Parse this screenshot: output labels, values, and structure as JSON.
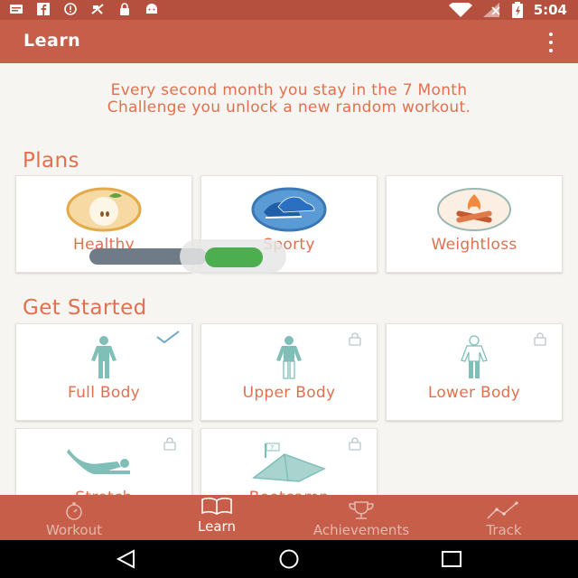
{
  "status": {
    "time": "5:04"
  },
  "appbar": {
    "title": "Learn"
  },
  "intro": {
    "line1": "Every second month you stay in the 7 Month",
    "line2": "Challenge you unlock a new random workout."
  },
  "plans": {
    "title": "Plans",
    "items": [
      {
        "label": "Healthy",
        "icon": "apple-icon"
      },
      {
        "label": "Sporty",
        "icon": "sneakers-icon"
      },
      {
        "label": "Weightloss",
        "icon": "campfire-icon"
      }
    ]
  },
  "toggle": {
    "state": "on"
  },
  "started": {
    "title": "Get Started",
    "items": [
      {
        "label": "Full Body",
        "status": "completed"
      },
      {
        "label": "Upper Body",
        "status": "locked"
      },
      {
        "label": "Lower Body",
        "status": "locked"
      },
      {
        "label": "Stretch",
        "status": "locked"
      },
      {
        "label": "Bootcamp",
        "status": "locked"
      }
    ]
  },
  "nav": {
    "items": [
      {
        "label": "Workout",
        "icon": "stopwatch-icon"
      },
      {
        "label": "Learn",
        "icon": "book-icon",
        "active": true
      },
      {
        "label": "Achievements",
        "icon": "trophy-icon"
      },
      {
        "label": "Track",
        "icon": "chart-icon"
      }
    ]
  },
  "colors": {
    "accent": "#c65e4a",
    "text_accent": "#e2704e",
    "figure": "#7fbfb8"
  }
}
